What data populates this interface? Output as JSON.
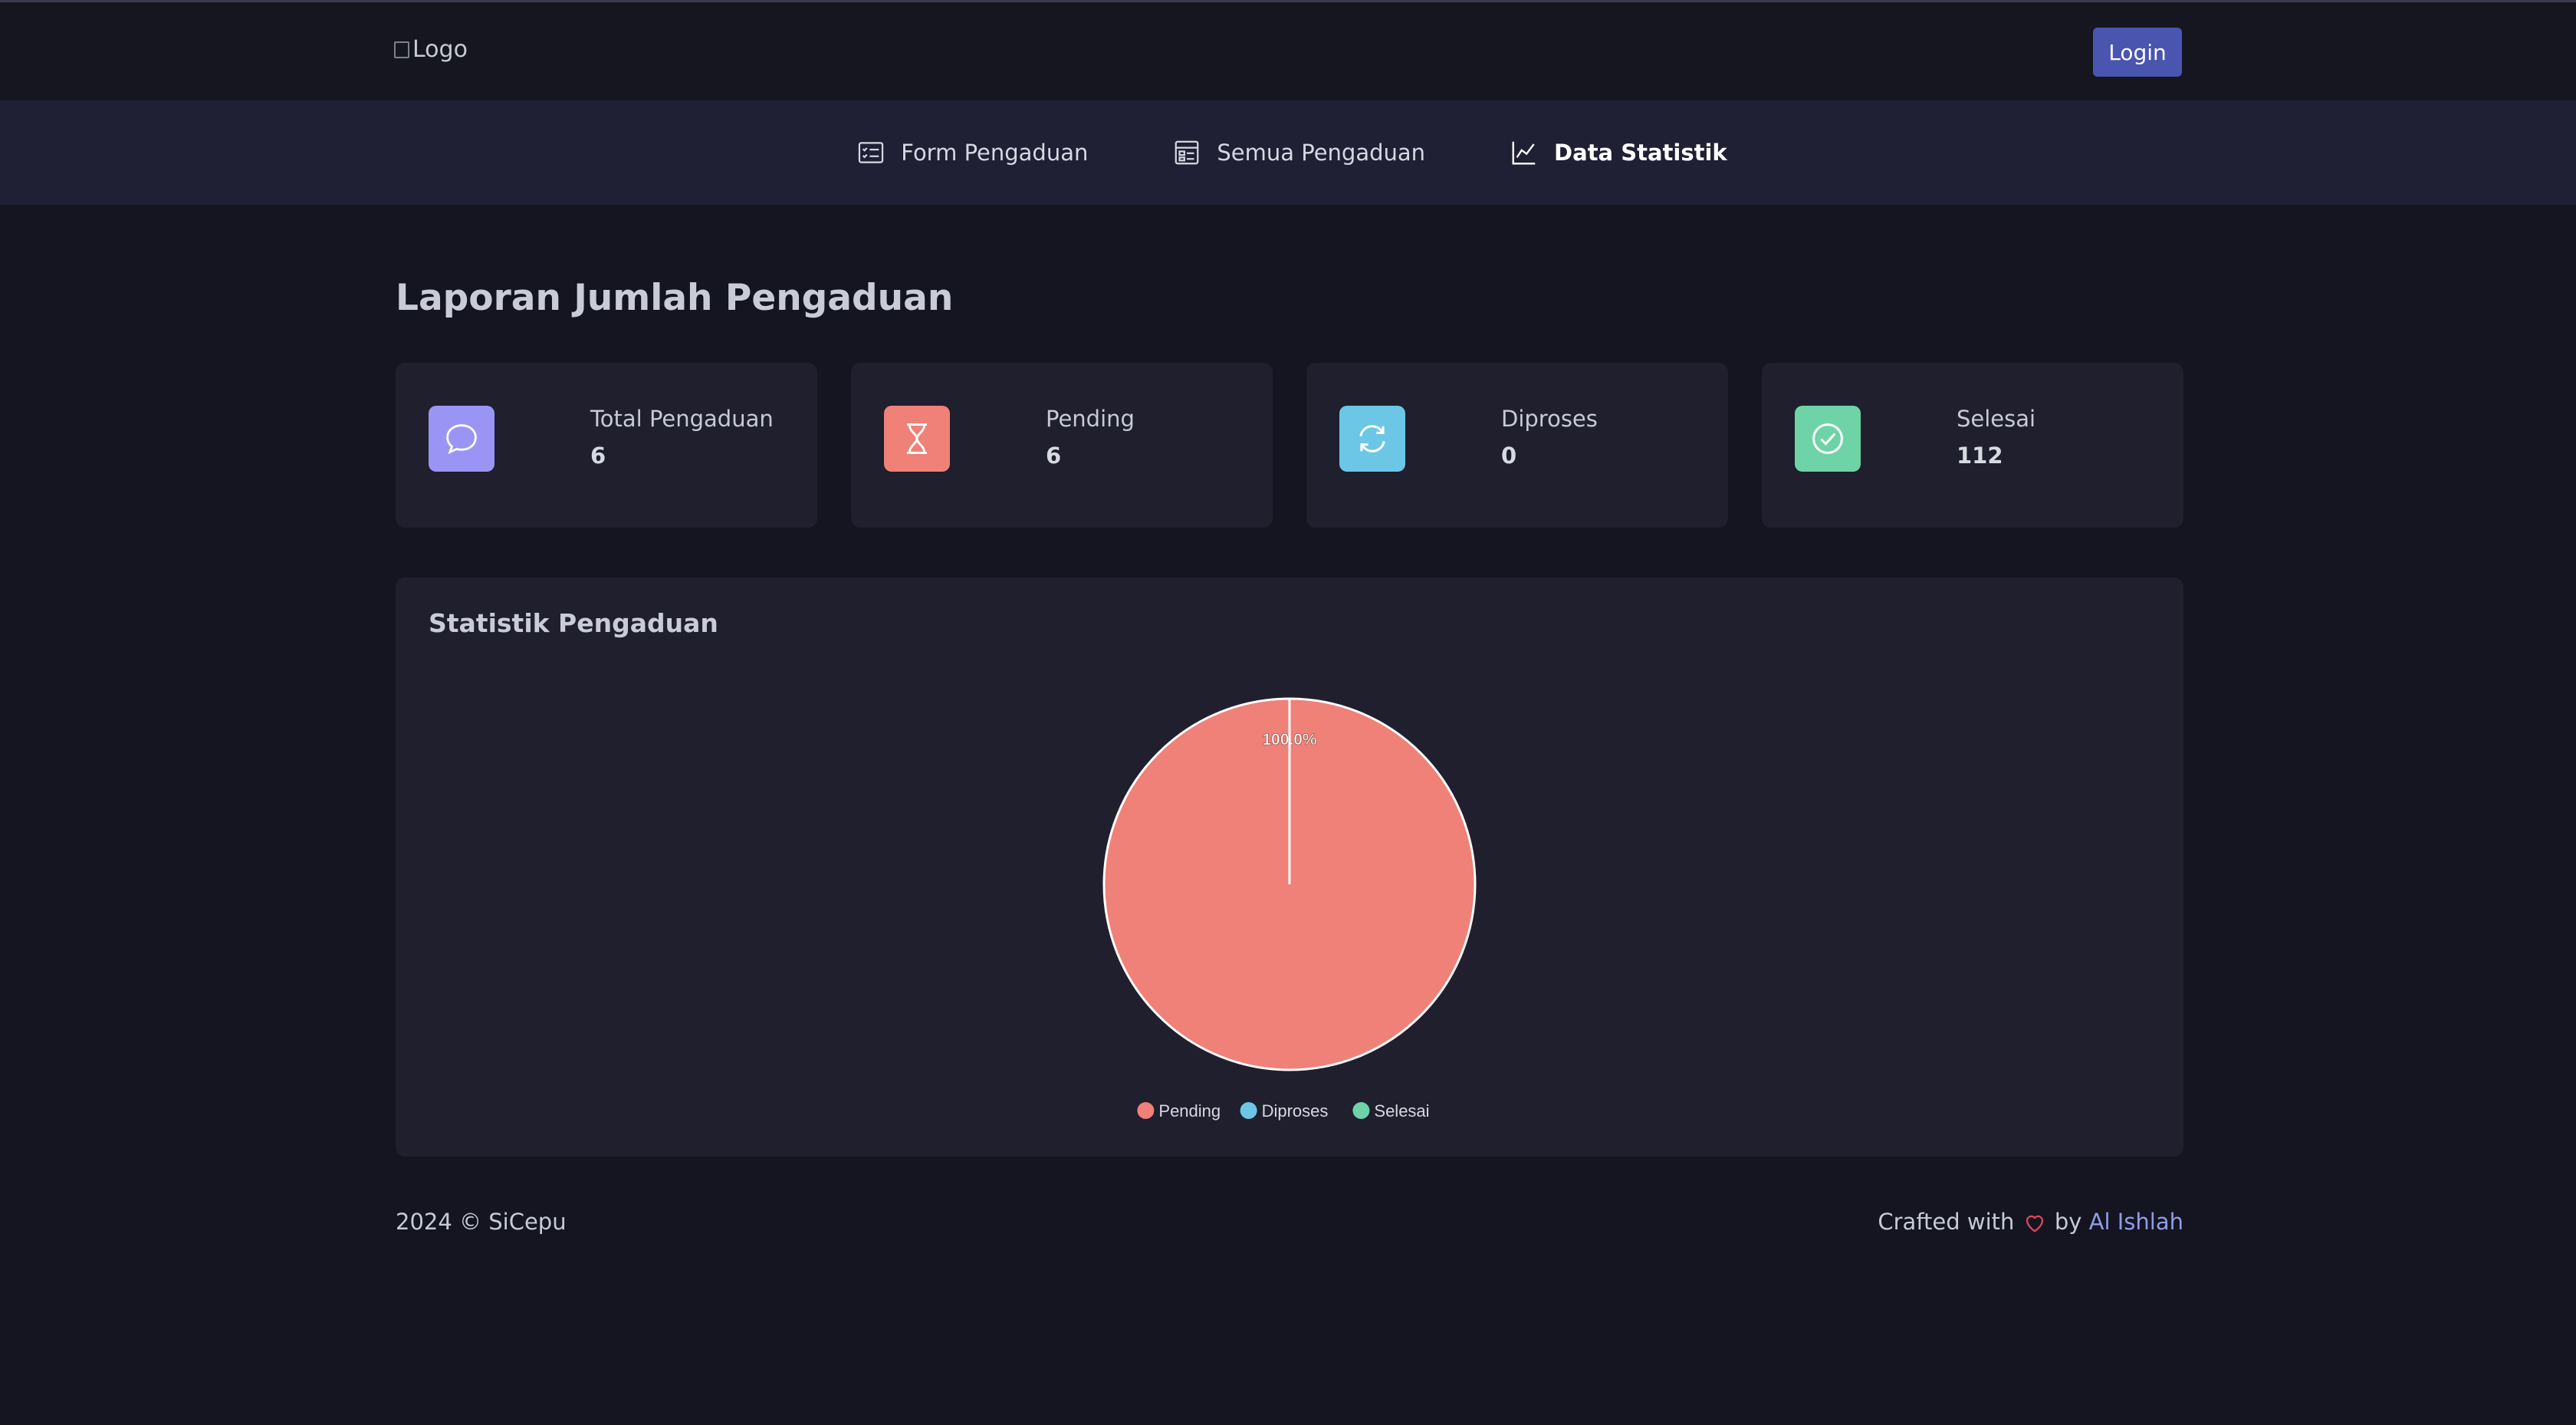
{
  "header": {
    "logo_alt": "Logo",
    "login_label": "Login"
  },
  "nav": {
    "items": [
      {
        "label": "Form Pengaduan",
        "icon": "form-list-icon"
      },
      {
        "label": "Semua Pengaduan",
        "icon": "table-list-icon"
      },
      {
        "label": "Data Statistik",
        "icon": "line-chart-icon",
        "active": true
      }
    ]
  },
  "page": {
    "title": "Laporan Jumlah Pengaduan"
  },
  "stats": [
    {
      "label": "Total Pengaduan",
      "value": "6",
      "icon": "chat-bubble-icon",
      "color": "#9a95f4"
    },
    {
      "label": "Pending",
      "value": "6",
      "icon": "hourglass-icon",
      "color": "#ef8178"
    },
    {
      "label": "Diproses",
      "value": "0",
      "icon": "refresh-icon",
      "color": "#6cc6e6"
    },
    {
      "label": "Selesai",
      "value": "112",
      "icon": "check-circle-icon",
      "color": "#6ed3a7"
    }
  ],
  "chart_panel": {
    "title": "Statistik Pengaduan"
  },
  "chart_data": {
    "type": "pie",
    "title": "",
    "categories": [
      "Pending",
      "Diproses",
      "Selesai"
    ],
    "values": [
      100.0,
      0,
      0
    ],
    "colors": [
      "#ef8178",
      "#6cc6e6",
      "#6ed3a7"
    ],
    "data_labels": [
      "100.0%"
    ],
    "legend_position": "bottom"
  },
  "footer": {
    "copyright": "2024 © SiCepu",
    "crafted_prefix": "Crafted with",
    "crafted_by": "by",
    "author": "Al Ishlah",
    "heart_icon": "heart-icon"
  }
}
